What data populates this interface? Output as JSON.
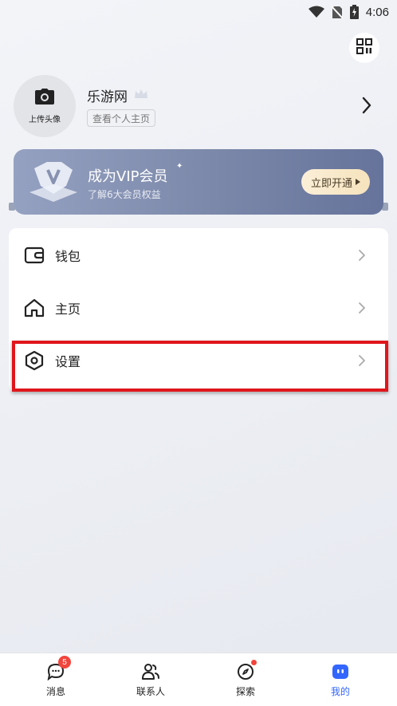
{
  "status_bar": {
    "time": "4:06"
  },
  "profile": {
    "avatar_label": "上传头像",
    "name": "乐游网",
    "view_profile_label": "查看个人主页"
  },
  "vip": {
    "title": "成为VIP会员",
    "subtitle": "了解6大会员权益",
    "button_label": "立即开通"
  },
  "menu": {
    "items": [
      {
        "label": "钱包",
        "icon": "wallet-icon"
      },
      {
        "label": "主页",
        "icon": "home-icon"
      },
      {
        "label": "设置",
        "icon": "settings-icon"
      }
    ]
  },
  "bottom_nav": {
    "items": [
      {
        "label": "消息",
        "icon": "message-icon",
        "badge": "5"
      },
      {
        "label": "联系人",
        "icon": "contacts-icon"
      },
      {
        "label": "探索",
        "icon": "compass-icon"
      },
      {
        "label": "我的",
        "icon": "profile-icon"
      }
    ]
  },
  "colors": {
    "accent": "#3366ff",
    "badge": "#f2453d",
    "highlight": "#e0161c",
    "vip_button": "#f6e3bd"
  }
}
